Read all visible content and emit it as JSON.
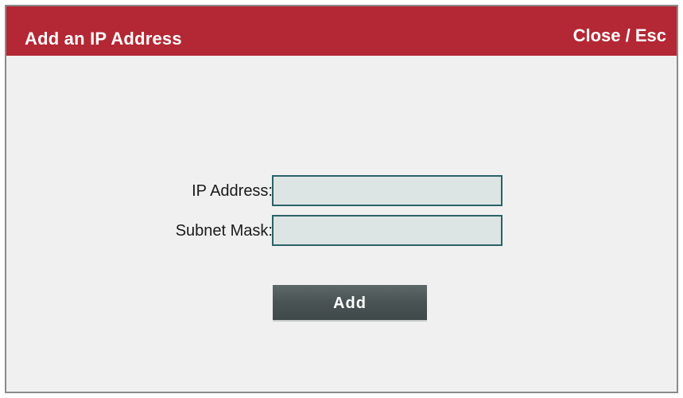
{
  "dialog": {
    "title": "Add an IP Address",
    "close_label": "Close / Esc"
  },
  "form": {
    "ip_address": {
      "label": "IP Address:",
      "value": "",
      "placeholder": ""
    },
    "subnet_mask": {
      "label": "Subnet Mask:",
      "value": "",
      "placeholder": ""
    },
    "add_label": "Add"
  },
  "colors": {
    "title_bar": "#b32834",
    "field_border": "#2b6267",
    "field_background": "#dde4e4",
    "button": "#4a5454"
  }
}
